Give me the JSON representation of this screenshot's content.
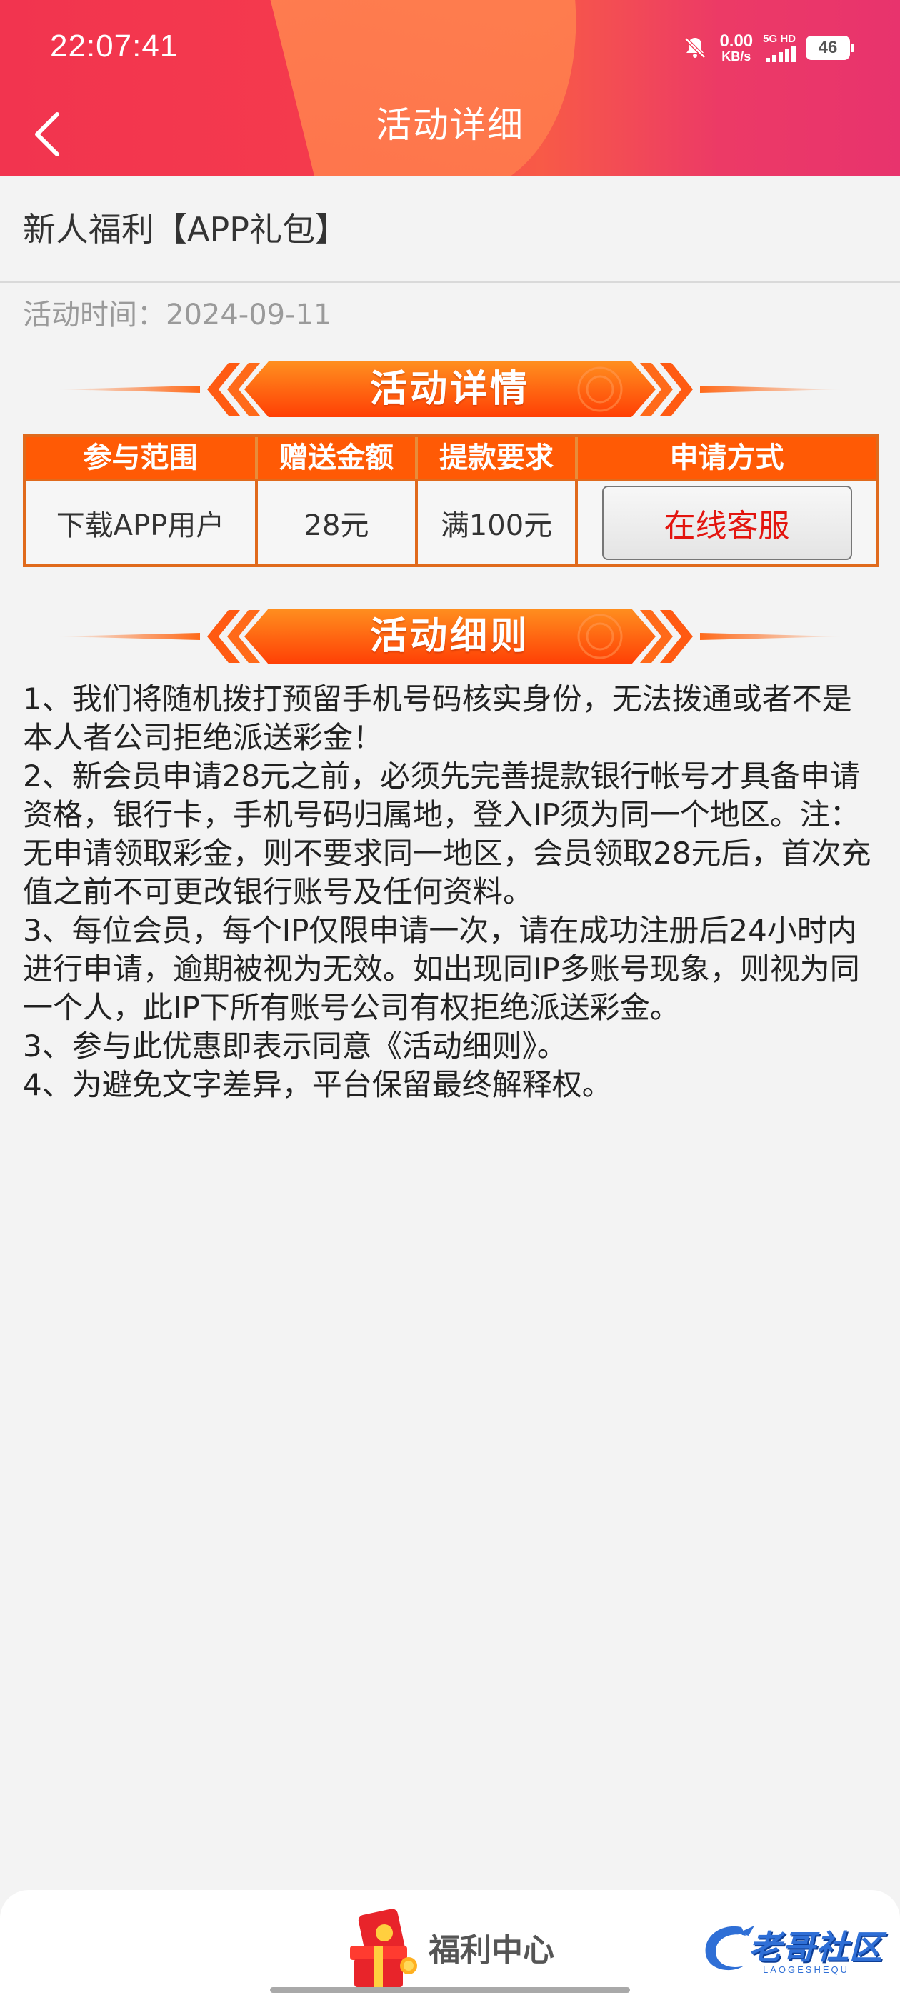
{
  "status_bar": {
    "time": "22:07:41",
    "net_speed_value": "0.00",
    "net_speed_unit": "KB/s",
    "signal_label": "5G HD",
    "battery": "46"
  },
  "header": {
    "title": "活动详细",
    "back_icon": "chevron-left-icon"
  },
  "promotion": {
    "title": "新人福利【APP礼包】",
    "time": "活动时间：2024-09-11"
  },
  "details_banner": "活动详情",
  "table": {
    "headers": [
      "参与范围",
      "赠送金额",
      "提款要求",
      "申请方式"
    ],
    "row": {
      "scope": "下载APP用户",
      "amount": "28元",
      "requirement": "满100元",
      "apply_button": "在线客服"
    }
  },
  "rules_banner": "活动细则",
  "rules": [
    "1、我们将随机拨打预留手机号码核实身份，无法拨通或者不是本人者公司拒绝派送彩金！",
    "2、新会员申请28元之前，必须先完善提款银行帐号才具备申请资格，银行卡，手机号码归属地，登入IP须为同一个地区。注：无申请领取彩金，则不要求同一地区，会员领取28元后，首次充值之前不可更改银行账号及任何资料。",
    "3、每位会员，每个IP仅限申请一次，请在成功注册后24小时内进行申请，逾期被视为无效。如出现同IP多账号现象，则视为同一个人，此IP下所有账号公司有权拒绝派送彩金。",
    "3、参与此优惠即表示同意《活动细则》。",
    "4、为避免文字差异，平台保留最终解释权。"
  ],
  "bottom_bar": {
    "welfare_label": "福利中心",
    "brand_name": "老哥社区",
    "brand_sub": "LAOGESHEQU"
  },
  "colors": {
    "header_red": "#f2344f",
    "accent_orange": "#ff5a05",
    "button_text_red": "#e3150f",
    "brand_blue": "#2f6fd6"
  }
}
